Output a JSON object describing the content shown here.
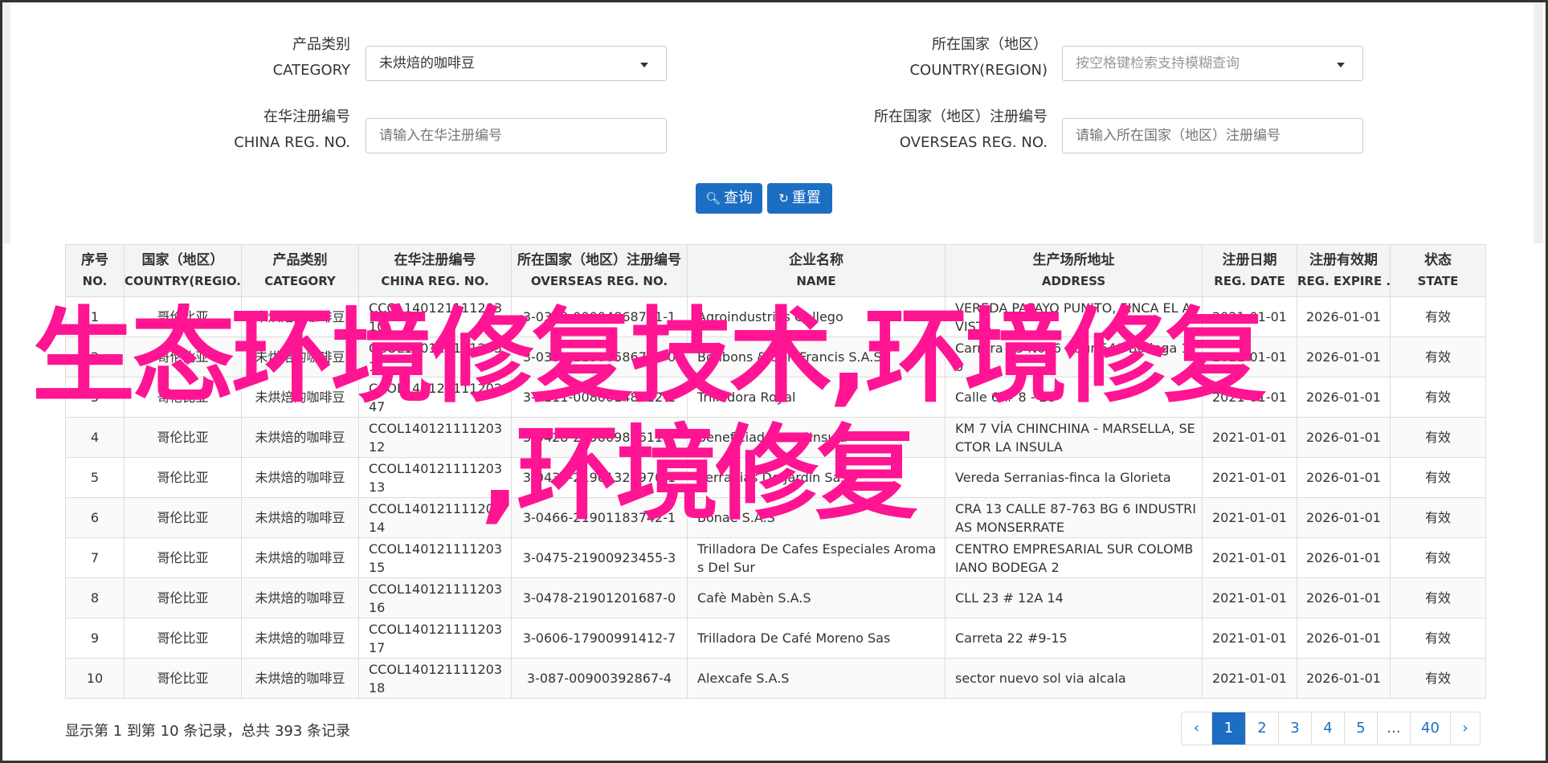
{
  "form": {
    "category_label_cn": "产品类别",
    "category_label_en": "CATEGORY",
    "category_value": "未烘焙的咖啡豆",
    "country_label_cn": "所在国家（地区）",
    "country_label_en": "COUNTRY(REGION)",
    "country_placeholder": "按空格键检索支持模糊查询",
    "china_reg_label_cn": "在华注册编号",
    "china_reg_label_en": "CHINA REG. NO.",
    "china_reg_placeholder": "请输入在华注册编号",
    "overseas_reg_label_cn": "所在国家（地区）注册编号",
    "overseas_reg_label_en": "OVERSEAS REG. NO.",
    "overseas_reg_placeholder": "请输入所在国家（地区）注册编号",
    "search_label": "查询",
    "reset_label": "重置"
  },
  "table": {
    "headers": [
      {
        "cn": "序号",
        "en": "NO."
      },
      {
        "cn": "国家（地区）",
        "en": "COUNTRY(REGIO..."
      },
      {
        "cn": "产品类别",
        "en": "CATEGORY"
      },
      {
        "cn": "在华注册编号",
        "en": "CHINA REG. NO."
      },
      {
        "cn": "所在国家（地区）注册编号",
        "en": "OVERSEAS REG. NO."
      },
      {
        "cn": "企业名称",
        "en": "NAME"
      },
      {
        "cn": "生产场所地址",
        "en": "ADDRESS"
      },
      {
        "cn": "注册日期",
        "en": "REG. DATE"
      },
      {
        "cn": "注册有效期",
        "en": "REG. EXPIRE ..."
      },
      {
        "cn": "状态",
        "en": "STATE"
      }
    ],
    "rows": [
      {
        "no": "1",
        "country": "哥伦比亚",
        "category": "未烘焙的咖啡豆",
        "china_reg": "CCOL14012111120310",
        "overseas_reg": "3-0390-00004868741-1",
        "name": "Agroindustrias Gallego",
        "address": "VEREDA PAPAYO PUNITO, FINCA EL AVISTA",
        "reg_date": "2021-01-01",
        "expire": "2026-01-01",
        "state": "有效"
      },
      {
        "no": "2",
        "country": "哥伦比亚",
        "category": "未烘焙的咖啡豆",
        "china_reg": "CCOL14012111120311",
        "overseas_reg": "3-0392-21900586775-0",
        "name": "Bonbons & San Francis S.A.S",
        "address": "Carrera 33 No. 6 - Sur 540 Bodega 10",
        "reg_date": "2021-01-01",
        "expire": "2026-01-01",
        "state": "有效"
      },
      {
        "no": "3",
        "country": "哥伦比亚",
        "category": "未烘焙的咖啡豆",
        "china_reg": "CCOL14012111120247",
        "overseas_reg": "3-0111-00800148312-1",
        "name": "Trilladora Royal",
        "address": "Calle 6 # 8 - 28",
        "reg_date": "2021-01-01",
        "expire": "2026-01-01",
        "state": "有效"
      },
      {
        "no": "4",
        "country": "哥伦比亚",
        "category": "未烘焙的咖啡豆",
        "china_reg": "CCOL14012111120312",
        "overseas_reg": "3-0428-21900988611-1",
        "name": "Beneficiadora La Insula",
        "address": "KM 7 VÍA CHINCHINA - MARSELLA, SECTOR LA INSULA",
        "reg_date": "2021-01-01",
        "expire": "2026-01-01",
        "state": "有效"
      },
      {
        "no": "5",
        "country": "哥伦比亚",
        "category": "未烘焙的咖啡豆",
        "china_reg": "CCOL14012111120313",
        "overseas_reg": "3-0430-21901323970-1",
        "name": "Serranias De Jardin Sas",
        "address": "Vereda Serranias-finca la Glorieta",
        "reg_date": "2021-01-01",
        "expire": "2026-01-01",
        "state": "有效"
      },
      {
        "no": "6",
        "country": "哥伦比亚",
        "category": "未烘焙的咖啡豆",
        "china_reg": "CCOL14012111120314",
        "overseas_reg": "3-0466-21901183742-1",
        "name": "Bonae S.A.S",
        "address": "CRA 13 CALLE 87-763 BG 6 INDUSTRIAS MONSERRATE",
        "reg_date": "2021-01-01",
        "expire": "2026-01-01",
        "state": "有效"
      },
      {
        "no": "7",
        "country": "哥伦比亚",
        "category": "未烘焙的咖啡豆",
        "china_reg": "CCOL14012111120315",
        "overseas_reg": "3-0475-21900923455-3",
        "name": "Trilladora De Cafes Especiales Aromas Del Sur",
        "address": "CENTRO EMPRESARIAL SUR COLOMBIANO BODEGA 2",
        "reg_date": "2021-01-01",
        "expire": "2026-01-01",
        "state": "有效"
      },
      {
        "no": "8",
        "country": "哥伦比亚",
        "category": "未烘焙的咖啡豆",
        "china_reg": "CCOL14012111120316",
        "overseas_reg": "3-0478-21901201687-0",
        "name": "Cafè Mabèn S.A.S",
        "address": "CLL 23 # 12A 14",
        "reg_date": "2021-01-01",
        "expire": "2026-01-01",
        "state": "有效"
      },
      {
        "no": "9",
        "country": "哥伦比亚",
        "category": "未烘焙的咖啡豆",
        "china_reg": "CCOL14012111120317",
        "overseas_reg": "3-0606-17900991412-7",
        "name": "Trilladora De Café Moreno Sas",
        "address": "Carreta 22 #9-15",
        "reg_date": "2021-01-01",
        "expire": "2026-01-01",
        "state": "有效"
      },
      {
        "no": "10",
        "country": "哥伦比亚",
        "category": "未烘焙的咖啡豆",
        "china_reg": "CCOL14012111120318",
        "overseas_reg": "3-087-00900392867-4",
        "name": "Alexcafe S.A.S",
        "address": "sector nuevo sol via alcala",
        "reg_date": "2021-01-01",
        "expire": "2026-01-01",
        "state": "有效"
      }
    ]
  },
  "summary": "显示第 1 到第 10 条记录，总共 393 条记录",
  "pagination": {
    "prev": "‹",
    "pages": [
      "1",
      "2",
      "3",
      "4",
      "5"
    ],
    "ellipsis": "...",
    "last": "40",
    "next": "›",
    "active": "1"
  },
  "watermark": {
    "line1": "生态环境修复技术,环境修复",
    "line2": ",环境修复"
  },
  "colors": {
    "primary": "#1b6ec2",
    "watermark": "#ff1493"
  }
}
